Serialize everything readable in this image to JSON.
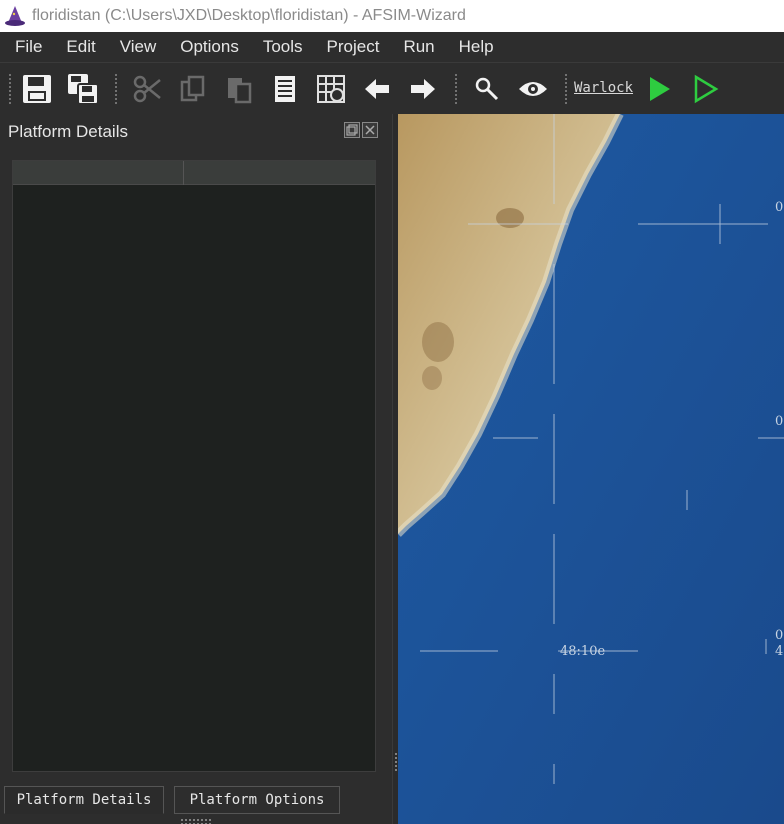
{
  "window": {
    "title": "floridistan (C:\\Users\\JXD\\Desktop\\floridistan) - AFSIM-Wizard",
    "app_icon": "wizard-hat-icon"
  },
  "menu": {
    "items": [
      "File",
      "Edit",
      "View",
      "Options",
      "Tools",
      "Project",
      "Run",
      "Help"
    ]
  },
  "toolbar": {
    "buttons": [
      {
        "name": "save-icon",
        "enabled": true
      },
      {
        "name": "save-all-icon",
        "enabled": true
      },
      {
        "name": "cut-icon",
        "enabled": false
      },
      {
        "name": "copy-icon",
        "enabled": false
      },
      {
        "name": "paste-icon",
        "enabled": false
      },
      {
        "name": "document-icon",
        "enabled": true
      },
      {
        "name": "grid-icon",
        "enabled": true
      },
      {
        "name": "back-arrow-icon",
        "enabled": true
      },
      {
        "name": "forward-arrow-icon",
        "enabled": true
      },
      {
        "name": "find-icon",
        "enabled": true
      },
      {
        "name": "eye-icon",
        "enabled": true
      },
      {
        "name": "run-icon",
        "enabled": true
      },
      {
        "name": "run-outline-icon",
        "enabled": true
      }
    ],
    "warlock_label": "Warlock",
    "run_color": "#2ecc40"
  },
  "left_panel": {
    "title": "Platform Details",
    "columns": [
      "",
      ""
    ],
    "tabs": [
      {
        "label": "Platform Details",
        "active": true
      },
      {
        "label": "Platform Options",
        "active": false
      }
    ]
  },
  "map": {
    "ocean_color": "#1b4f93",
    "land_color": "#c2a878",
    "labels": {
      "edge_label_1": "0",
      "edge_label_2": "0",
      "edge_label_3": "0",
      "edge_label_4": "4",
      "longitude_label": "48:10e"
    }
  }
}
